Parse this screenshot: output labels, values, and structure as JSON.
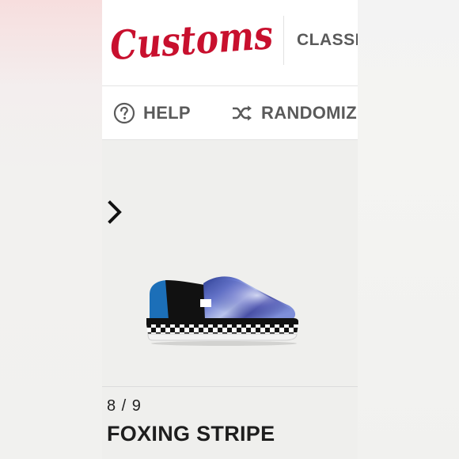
{
  "header": {
    "logo_text": "Customs",
    "category_tab": "CLASSIC"
  },
  "toolbar": {
    "help_label": "HELP",
    "randomize_label": "RANDOMIZE"
  },
  "step": {
    "counter": "8 / 9",
    "title": "FOXING STRIPE"
  },
  "colors": {
    "brand_red": "#c8102e",
    "toolbar_text": "#5a5a5a",
    "heel_blue": "#1c6fb8",
    "upper_black": "#111111"
  },
  "icons": {
    "help": "question-circle",
    "randomize": "shuffle",
    "next": "chevron-right"
  }
}
